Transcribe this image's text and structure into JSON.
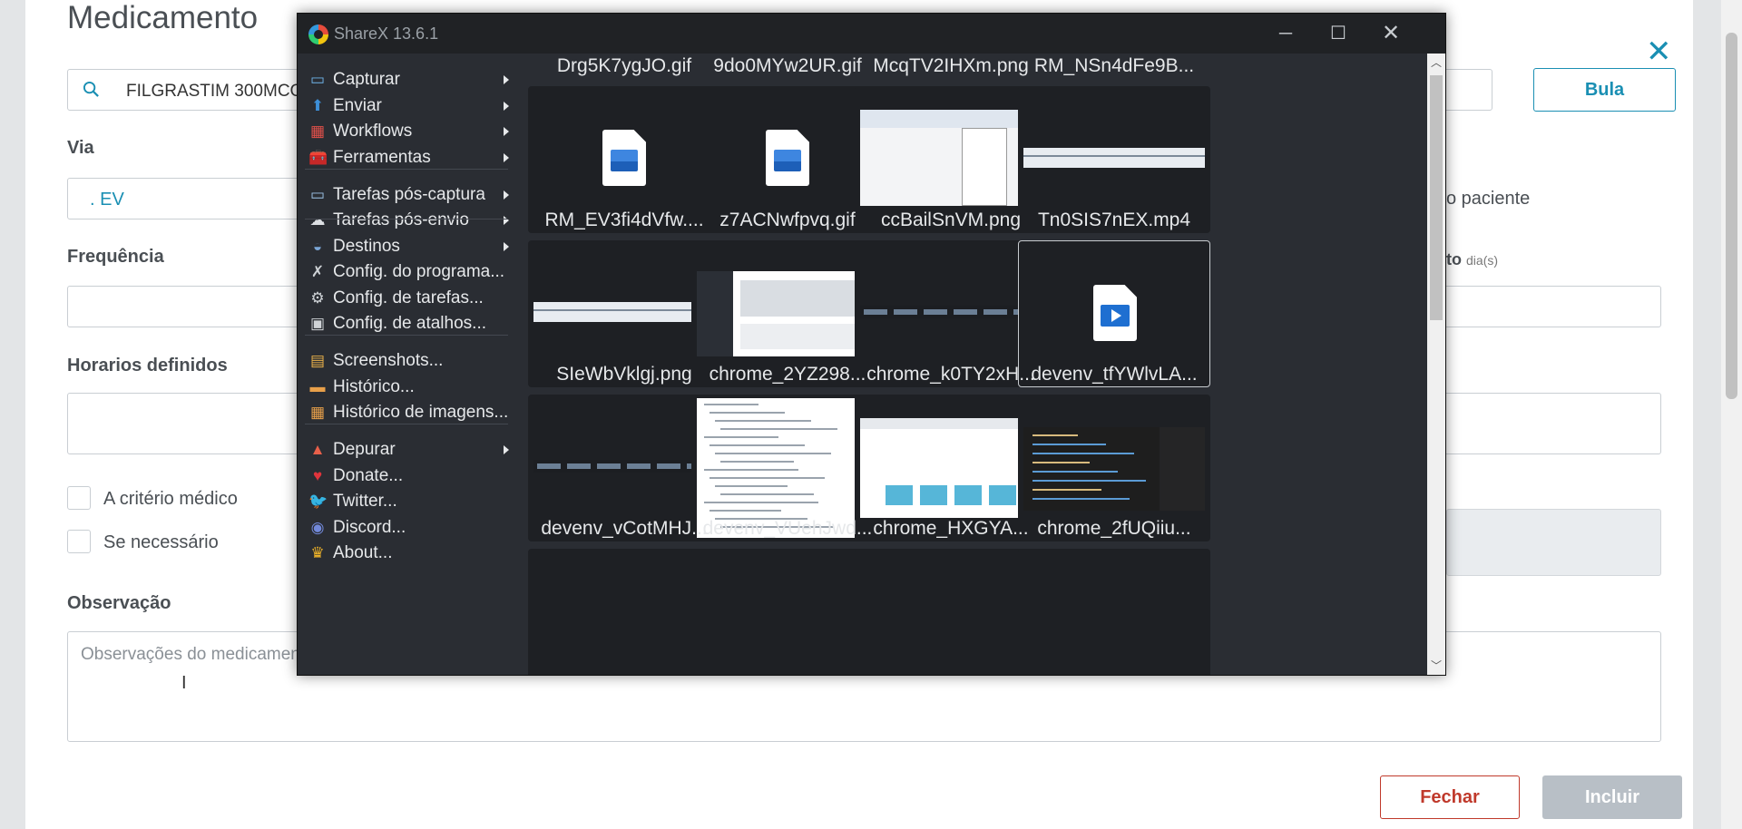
{
  "form": {
    "title": "Medicamento",
    "search_value": "FILGRASTIM 300MCG/",
    "bula_label": "Bula",
    "via_label": "Via",
    "via_value": ". EV",
    "frequencia_label": "Frequência",
    "horarios_label": "Horarios definidos",
    "criterio_label": "A critério médico",
    "necessario_label": "Se necessário",
    "observacao_label": "Observação",
    "observacao_placeholder": "Observações do medicament",
    "paciente_text": "o paciente",
    "duracao_label": "to",
    "duracao_unit": "dia(s)",
    "fechar_label": "Fechar",
    "incluir_label": "Incluir"
  },
  "sharex": {
    "title": "ShareX 13.6.1",
    "menu": [
      {
        "label": "Capturar",
        "icon": "capture-icon",
        "submenu": true
      },
      {
        "label": "Enviar",
        "icon": "upload-icon",
        "submenu": true
      },
      {
        "label": "Workflows",
        "icon": "workflows-icon",
        "submenu": true
      },
      {
        "label": "Ferramentas",
        "icon": "toolbox-icon",
        "submenu": true
      },
      {
        "label": "Tarefas pós-captura",
        "icon": "after-capture-icon",
        "submenu": true
      },
      {
        "label": "Tarefas pós-envio",
        "icon": "after-upload-icon",
        "submenu": true
      },
      {
        "label": "Destinos",
        "icon": "destinations-icon",
        "submenu": true
      },
      {
        "label": "Config. do programa...",
        "icon": "wrench-icon",
        "submenu": false
      },
      {
        "label": "Config. de tarefas...",
        "icon": "gear-icon",
        "submenu": false
      },
      {
        "label": "Config. de atalhos...",
        "icon": "keyboard-icon",
        "submenu": false
      },
      {
        "label": "Screenshots...",
        "icon": "screenshots-icon",
        "submenu": false
      },
      {
        "label": "Histórico...",
        "icon": "history-icon",
        "submenu": false
      },
      {
        "label": "Histórico de imagens...",
        "icon": "image-history-icon",
        "submenu": false
      },
      {
        "label": "Depurar",
        "icon": "debug-icon",
        "submenu": true
      },
      {
        "label": "Donate...",
        "icon": "heart-icon",
        "submenu": false
      },
      {
        "label": "Twitter...",
        "icon": "twitter-icon",
        "submenu": false
      },
      {
        "label": "Discord...",
        "icon": "discord-icon",
        "submenu": false
      },
      {
        "label": "About...",
        "icon": "crown-icon",
        "submenu": false
      }
    ],
    "files": [
      {
        "name": "Drg5K7ygJO.gif",
        "kind": "image-file"
      },
      {
        "name": "9do0MYw2UR.gif",
        "kind": "image-file"
      },
      {
        "name": "McqTV2IHXm.png",
        "kind": "screenshot-light"
      },
      {
        "name": "RM_NSn4dFe9B...",
        "kind": "screenshot-strip"
      },
      {
        "name": "RM_EV3fi4dVfw....",
        "kind": "screenshot-strip"
      },
      {
        "name": "z7ACNwfpvq.gif",
        "kind": "screenshot-app"
      },
      {
        "name": "ccBailSnVM.png",
        "kind": "screenshot-taskbar"
      },
      {
        "name": "Tn0SIS7nEX.mp4",
        "kind": "video-file"
      },
      {
        "name": "SIeWbVklgj.png",
        "kind": "screenshot-taskbar"
      },
      {
        "name": "chrome_2YZ298...",
        "kind": "screenshot-json"
      },
      {
        "name": "chrome_k0TY2xH...",
        "kind": "screenshot-web"
      },
      {
        "name": "devenv_tfYWlvLA...",
        "kind": "screenshot-ide"
      },
      {
        "name": "devenv_vCotMHJ...",
        "kind": "partial"
      },
      {
        "name": "devenv_VUehJwd...",
        "kind": "partial"
      },
      {
        "name": "chrome_HXGYA...",
        "kind": "partial"
      },
      {
        "name": "chrome_2fUQiiu...",
        "kind": "partial"
      }
    ]
  }
}
